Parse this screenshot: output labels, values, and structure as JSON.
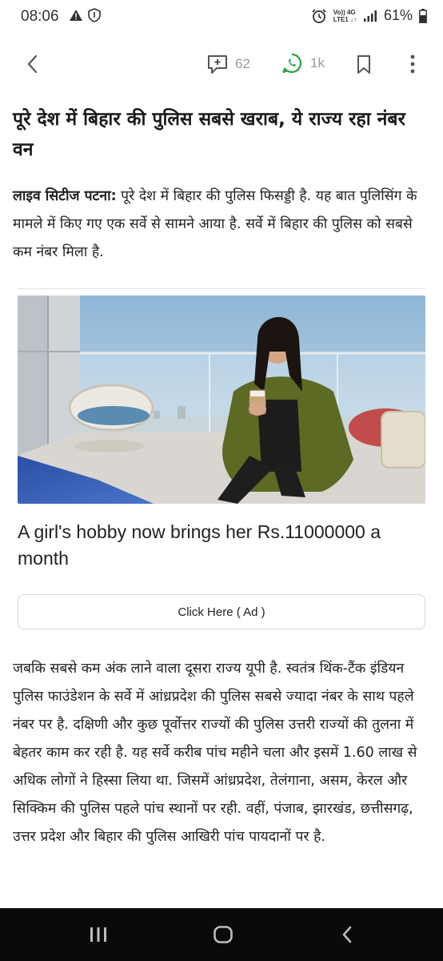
{
  "status_bar": {
    "time": "08:06",
    "left_icons": [
      "warning-icon",
      "shield-one-icon"
    ],
    "alarm_icon": "alarm-icon",
    "net_top": "Vo)) 4G",
    "net_bottom": "LTE1 ↓↑",
    "battery": "61%"
  },
  "toolbar": {
    "comment_count": "62",
    "share_count": "1k",
    "colors": {
      "whatsapp": "#25a244",
      "icon": "#555555"
    }
  },
  "article": {
    "headline": "पूरे देश में बिहार की पुलिस सबसे खराब, ये राज्य रहा नंबर वन",
    "lead_source": "लाइव सिटीज पटना:",
    "lead_text": " पूरे देश में बिहार की पुलिस फिसड्डी है. यह बात पुलिसिंग के मामले में किए गए एक सर्वे से सामने आया है. सर्वे में बिहार की पुलिस को सबसे कम नंबर मिला है.",
    "body": "जबकि सबसे कम अंक लाने वाला दूसरा राज्य यूपी है. स्वतंत्र थिंक-टैंक इंडियन पुलिस फाउंडेशन के सर्वे में आंध्रप्रदेश की पुलिस सबसे ज्यादा नंबर के साथ पहले नंबर पर है. दक्षिणी और कुछ पूर्वोत्तर राज्यों की पुलिस उत्तरी राज्यों की तुलना में बेहतर काम कर रही है. यह सर्वे करीब पांच महीने चला और इसमें 1.60 लाख से अधिक लोगों ने हिस्सा लिया था. जिसमें आंध्रप्रदेश, तेलंगाना, असम, केरल और सिक्किम की पुलिस पहले पांच स्थानों पर रही. वहीं, पंजाब, झारखंड, छत्तीसगढ़, उत्तर प्रदेश और बिहार की पुलिस आखिरी पांच पायदानों पर है."
  },
  "ad": {
    "title": "A girl's hobby now brings her Rs.11000000 a month",
    "button_label": "Click Here ( Ad )"
  },
  "nav": {
    "icons": [
      "recent-apps-icon",
      "home-icon",
      "back-icon"
    ]
  }
}
